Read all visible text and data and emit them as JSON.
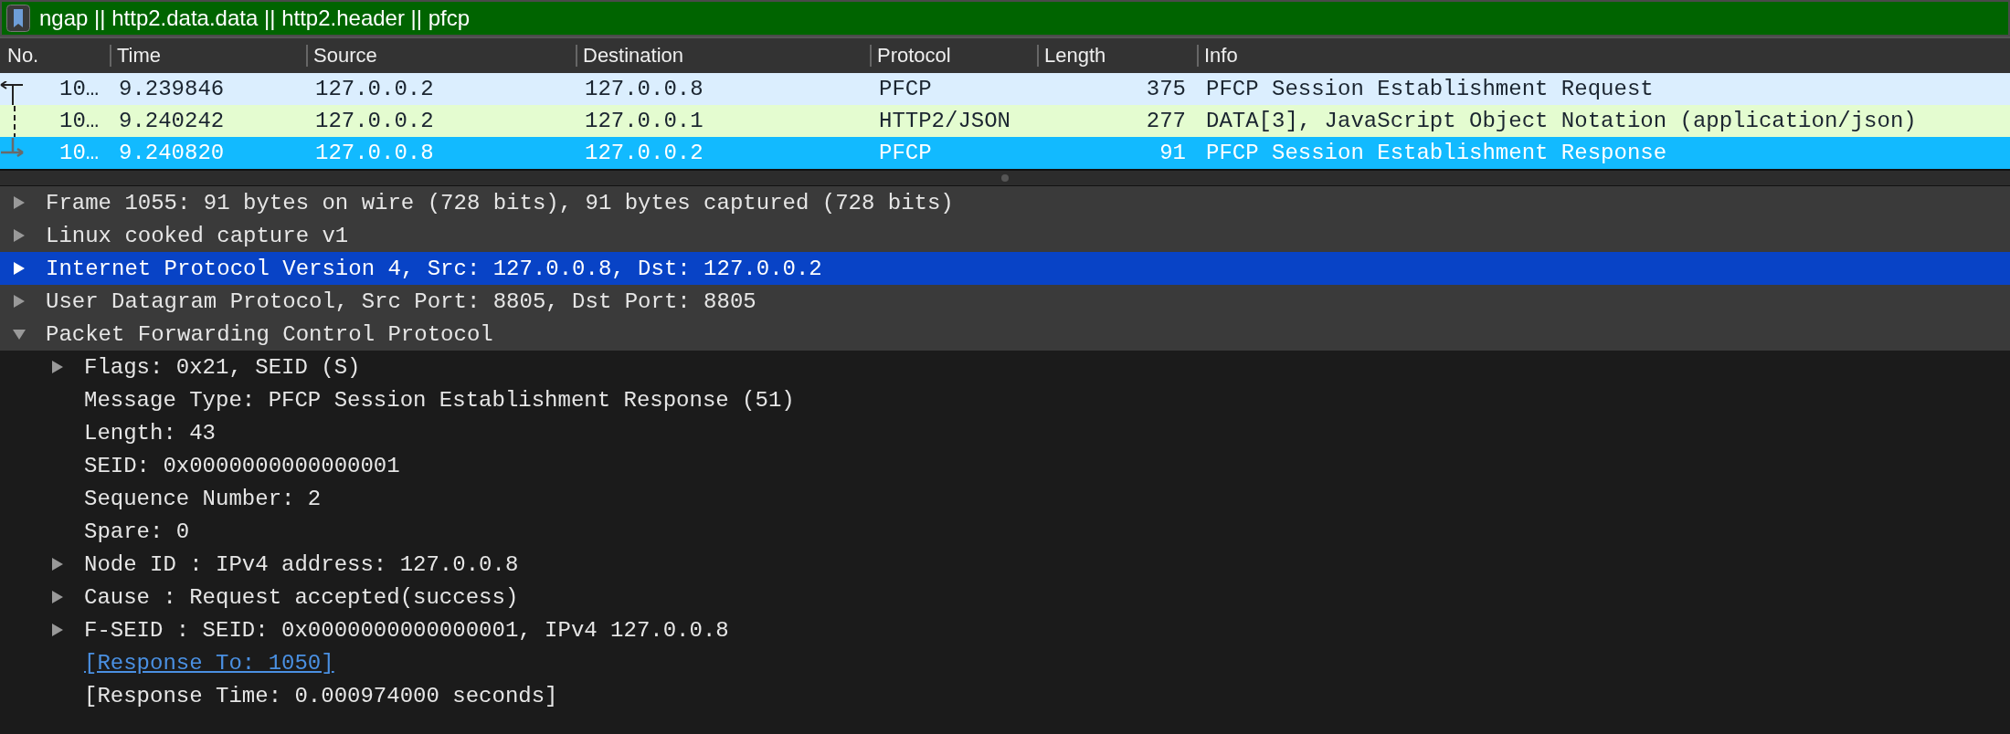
{
  "filter": {
    "value": "ngap || http2.data.data || http2.header || pfcp"
  },
  "columns": [
    "No.",
    "Time",
    "Source",
    "Destination",
    "Protocol",
    "Length",
    "Info"
  ],
  "packets": [
    {
      "no": "10…",
      "kind": "request",
      "time": "9.239846",
      "source": "127.0.0.2",
      "destination": "127.0.0.8",
      "protocol": "PFCP",
      "length": "375",
      "info": "PFCP Session Establishment Request",
      "color": "#dbeefe",
      "selected": false
    },
    {
      "no": "10…",
      "kind": "related",
      "time": "9.240242",
      "source": "127.0.0.2",
      "destination": "127.0.0.1",
      "protocol": "HTTP2/JSON",
      "length": "277",
      "info": "DATA[3], JavaScript Object Notation (application/json)",
      "color": "#e4fcd0",
      "selected": false
    },
    {
      "no": "10…",
      "kind": "response",
      "time": "9.240820",
      "source": "127.0.0.8",
      "destination": "127.0.0.2",
      "protocol": "PFCP",
      "length": "91",
      "info": "PFCP Session Establishment Response",
      "color": "#12baff",
      "selected": true
    }
  ],
  "details": [
    {
      "kind": "branch",
      "label": "Frame 1055: 91 bytes on wire (728 bits), 91 bytes captured (728 bits)",
      "expanded": false,
      "selected": false
    },
    {
      "kind": "branch",
      "label": "Linux cooked capture v1",
      "expanded": false,
      "selected": false
    },
    {
      "kind": "branch",
      "label": "Internet Protocol Version 4, Src: 127.0.0.8, Dst: 127.0.0.2",
      "expanded": false,
      "selected": true
    },
    {
      "kind": "branch",
      "label": "User Datagram Protocol, Src Port: 8805, Dst Port: 8805",
      "expanded": false,
      "selected": false
    },
    {
      "kind": "branch",
      "label": "Packet Forwarding Control Protocol",
      "expanded": true,
      "selected": false,
      "children": [
        {
          "kind": "branch",
          "label": "Flags: 0x21, SEID (S)",
          "expanded": false,
          "selected": false
        },
        {
          "kind": "leaf",
          "label": "Message Type: PFCP Session Establishment Response (51)",
          "selected": false
        },
        {
          "kind": "leaf",
          "label": "Length: 43",
          "selected": false
        },
        {
          "kind": "leaf",
          "label": "SEID: 0x0000000000000001",
          "selected": false
        },
        {
          "kind": "leaf",
          "label": "Sequence Number: 2",
          "selected": false
        },
        {
          "kind": "leaf",
          "label": "Spare: 0",
          "selected": false
        },
        {
          "kind": "branch",
          "label": "Node ID : IPv4 address: 127.0.0.8",
          "expanded": false,
          "selected": false
        },
        {
          "kind": "branch",
          "label": "Cause : Request accepted(success)",
          "expanded": false,
          "selected": false
        },
        {
          "kind": "branch",
          "label": "F-SEID : SEID: 0x0000000000000001, IPv4 127.0.0.8",
          "expanded": false,
          "selected": false
        },
        {
          "kind": "link",
          "label": "[Response To: 1050]",
          "selected": false
        },
        {
          "kind": "leaf",
          "label": "[Response Time: 0.000974000 seconds]",
          "selected": false
        }
      ]
    }
  ]
}
